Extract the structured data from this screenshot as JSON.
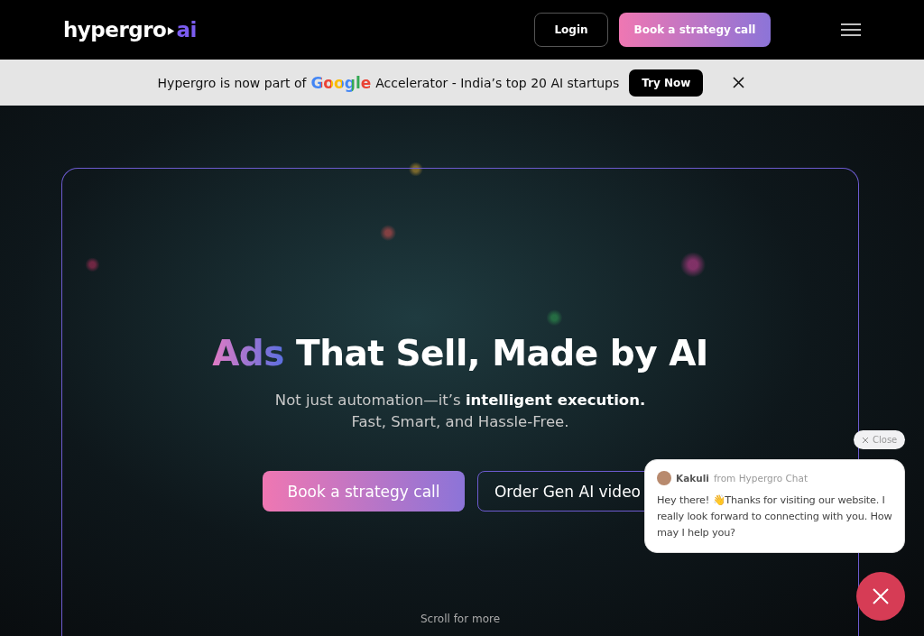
{
  "header": {
    "logo": {
      "name": "hypergro",
      "suffix": "ai"
    },
    "login_button": "Login",
    "cta_button": "Book a strategy call"
  },
  "banner": {
    "text_before": "Hypergro is now part of",
    "google": "Google",
    "text_after": "Accelerator - India’s top 20 AI startups",
    "button": "Try Now"
  },
  "hero": {
    "title_highlight": "Ads",
    "title_rest": "That Sell, Made by AI",
    "subtitle": "Not just automation—it’s **intelligent execution.**",
    "subtitle_line2": "Fast, Smart, and Hassle-Free.",
    "primary_button": "Book a strategy call",
    "secondary_button": "Order Gen AI video",
    "scroll_hint": "Scroll for more"
  },
  "chat": {
    "close_label": "Close",
    "agent": "Kakuli",
    "source": "from Hypergro Chat",
    "message": "Hey there! 👋Thanks for visiting our website. I really look forward to connecting with you. How may I help you?"
  }
}
